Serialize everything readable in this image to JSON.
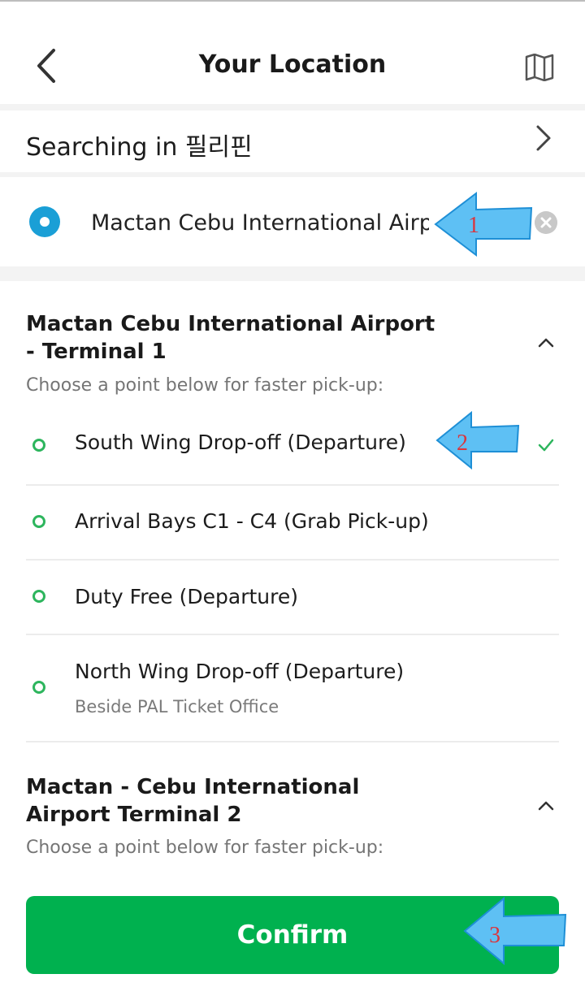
{
  "header": {
    "title": "Your Location",
    "back_icon": "back-chevron-icon",
    "map_icon": "map-icon"
  },
  "search_scope": {
    "label": "Searching in 필리핀"
  },
  "location": {
    "value": "Mactan Cebu International Airport",
    "accent": "#1a9fd6"
  },
  "sections": [
    {
      "title": "Mactan Cebu International Airport - Terminal 1",
      "subtitle": "Choose a point below for faster pick-up:",
      "items": [
        {
          "name": "South Wing Drop-off (Departure)",
          "selected": true
        },
        {
          "name": "Arrival Bays C1 - C4 (Grab Pick-up)"
        },
        {
          "name": "Duty Free (Departure)"
        },
        {
          "name": "North Wing Drop-off (Departure)",
          "desc": "Beside PAL Ticket Office"
        }
      ]
    },
    {
      "title": "Mactan - Cebu International Airport Terminal 2",
      "subtitle": "Choose a point below for faster pick-up:"
    }
  ],
  "confirm": {
    "label": "Confirm",
    "color": "#00b14f"
  },
  "annotations": [
    {
      "number": "1"
    },
    {
      "number": "2"
    },
    {
      "number": "3"
    }
  ]
}
